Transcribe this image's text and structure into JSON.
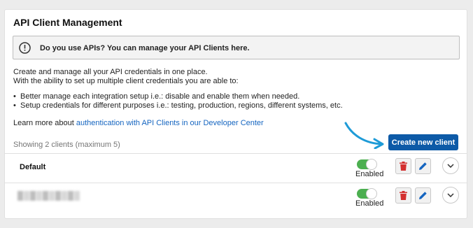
{
  "header": {
    "title": "API Client Management"
  },
  "notice": {
    "text": "Do you use APIs? You can manage your API Clients here."
  },
  "intro": {
    "line1": "Create and manage all your API credentials in one place.",
    "line2": "With the ability to set up multiple client credentials you are able to:"
  },
  "bullets": [
    "Better manage each integration setup i.e.: disable and enable them when needed.",
    "Setup credentials for different purposes i.e.: testing, production, regions, different systems, etc."
  ],
  "learn_more": {
    "prefix": "Learn more about ",
    "link": "authentication with API Clients in our Developer Center"
  },
  "clients_count": "Showing 2 clients (maximum 5)",
  "create_button": "Create new client",
  "clients": [
    {
      "name": "Default",
      "status": "Enabled",
      "enabled": true
    },
    {
      "name": "",
      "status": "Enabled",
      "enabled": true
    }
  ],
  "colors": {
    "primary": "#0d5aa7",
    "link": "#1565c0",
    "arrow": "#1e9bd7",
    "toggle_on": "#4caf50",
    "delete": "#d32f2f",
    "edit": "#1565c0"
  },
  "icons": {
    "notice": "exclamation-circle-icon",
    "arrow": "curved-arrow-icon",
    "delete": "trash-icon",
    "edit": "pencil-icon",
    "expand": "chevron-down-icon"
  }
}
